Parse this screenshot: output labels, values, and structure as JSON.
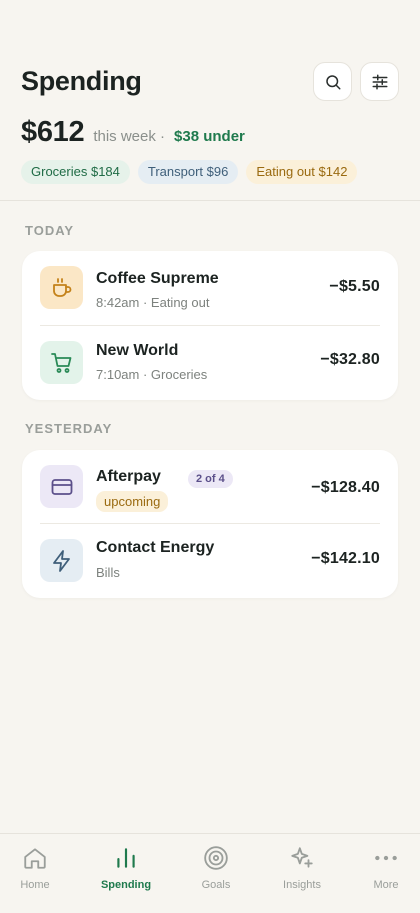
{
  "header": {
    "title": "Spending",
    "search_icon": "search-icon",
    "filter_icon": "sliders-icon"
  },
  "summary": {
    "amount": "$612",
    "period": "this week ·",
    "under": "$38 under"
  },
  "chips": [
    {
      "label": "Groceries $184",
      "color": "#1f6b45"
    },
    {
      "label": "Transport $96",
      "color": "#3f5f7a"
    },
    {
      "label": "Eating out $142",
      "color": "#9a6a10"
    }
  ],
  "sections": {
    "today": {
      "label": "TODAY",
      "items": [
        {
          "name": "Coffee Supreme",
          "meta": "8:42am · Eating out",
          "amount": "−$5.50",
          "icon": "coffee-cup-icon"
        },
        {
          "name": "New World",
          "meta": "7:10am · Groceries",
          "amount": "−$32.80",
          "icon": "shopping-cart-icon"
        }
      ]
    },
    "yesterday": {
      "label": "YESTERDAY",
      "items": [
        {
          "name": "Afterpay",
          "badge": "2 of 4",
          "status": "upcoming",
          "amount": "−$128.40",
          "icon": "credit-card-icon"
        },
        {
          "name": "Contact Energy",
          "meta": "Bills",
          "amount": "−$142.10",
          "icon": "lightning-icon"
        }
      ]
    }
  },
  "tabbar": {
    "tabs": [
      {
        "label": "Home",
        "icon": "home-icon"
      },
      {
        "label": "Spending",
        "icon": "bar-chart-icon",
        "active": true
      },
      {
        "label": "Goals",
        "icon": "target-icon"
      },
      {
        "label": "Insights",
        "icon": "sparkle-icon"
      },
      {
        "label": "More",
        "icon": "more-dots-icon"
      }
    ]
  },
  "colors": {
    "accent": "#1f7a4d",
    "background": "#f7f5f0",
    "card": "#ffffff"
  }
}
